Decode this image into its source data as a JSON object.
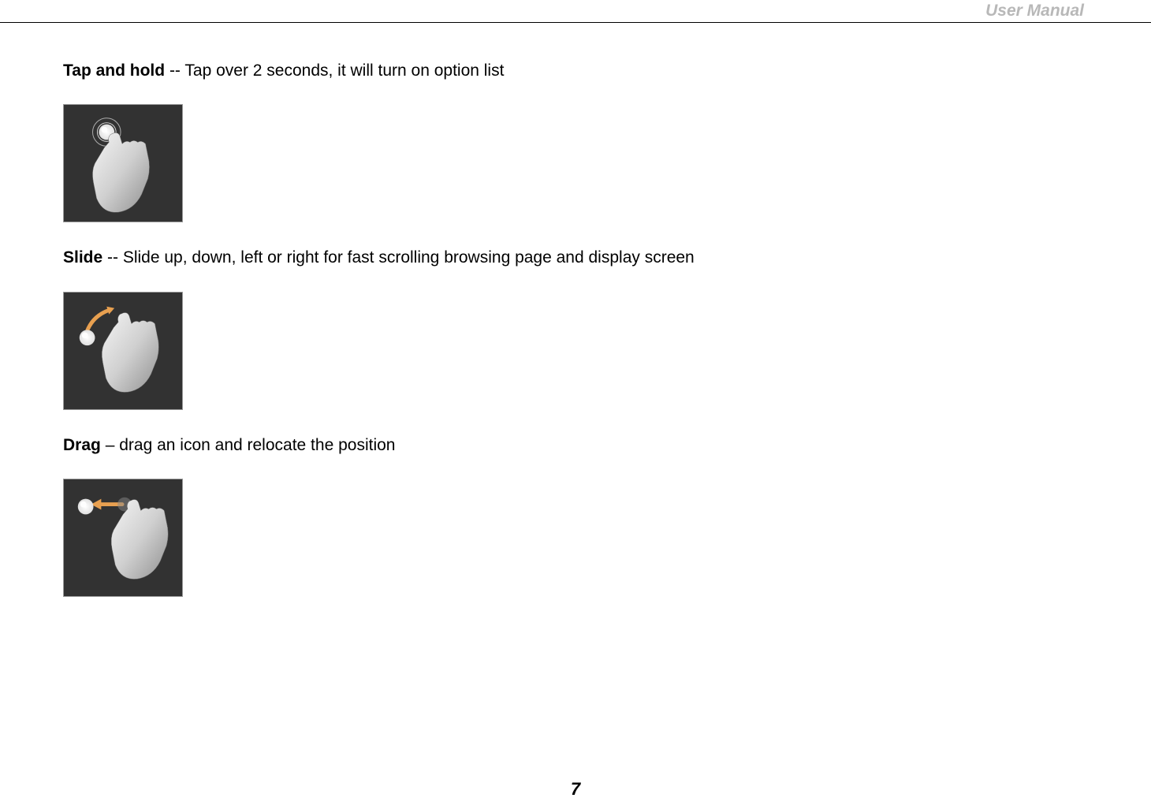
{
  "header": {
    "title": "User Manual"
  },
  "gestures": [
    {
      "label": "Tap and hold",
      "separator": " -- ",
      "description": "Tap over 2 seconds, it will turn on option list"
    },
    {
      "label": "Slide",
      "separator": " -- ",
      "description": "Slide up, down, left or right for fast scrolling browsing page and display screen"
    },
    {
      "label": "Drag",
      "separator": " – ",
      "description": "drag an icon and relocate the position"
    }
  ],
  "page_number": "7"
}
